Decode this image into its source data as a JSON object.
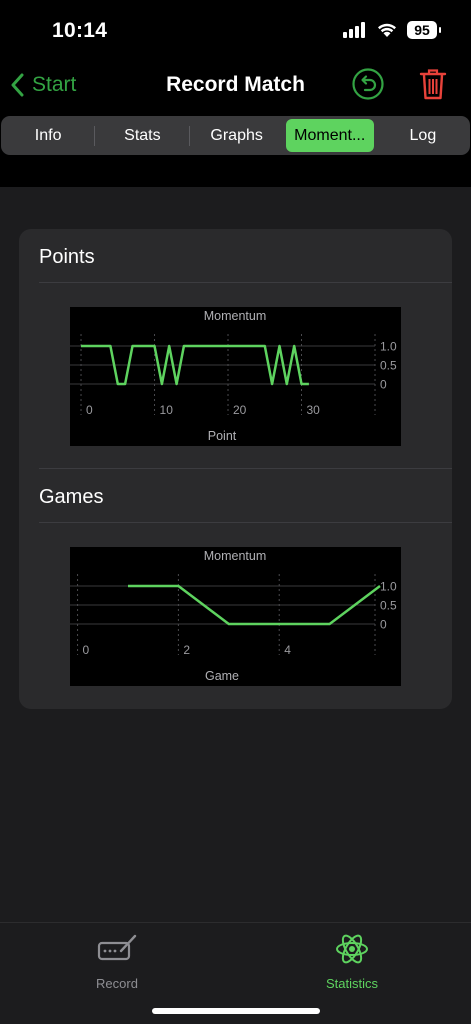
{
  "status": {
    "time": "10:14",
    "battery": "95"
  },
  "nav": {
    "back_label": "Start",
    "title": "Record Match"
  },
  "tabs": [
    {
      "label": "Info"
    },
    {
      "label": "Stats"
    },
    {
      "label": "Graphs"
    },
    {
      "label": "Moment..."
    },
    {
      "label": "Log"
    }
  ],
  "active_tab": 3,
  "sections": {
    "points_title": "Points",
    "games_title": "Games"
  },
  "colors": {
    "accent": "#5ed35f",
    "back_green": "#33a343",
    "trash_red": "#e8423a"
  },
  "chart_data": [
    {
      "type": "line",
      "title": "Momentum",
      "xlabel": "Point",
      "ylabel": "",
      "xlim": [
        -1.5,
        40
      ],
      "ylim": [
        0,
        1
      ],
      "x_ticks": [
        0,
        10,
        20,
        30
      ],
      "x_tick_labels": [
        "0",
        "10",
        "20",
        "30"
      ],
      "y_ticks": [
        0,
        0.5,
        1
      ],
      "y_tick_labels": [
        "0",
        "0.5",
        "1.0"
      ],
      "grid": true,
      "series": [
        {
          "x": [
            0,
            4,
            5,
            6,
            7,
            10,
            11,
            12,
            13,
            14,
            15,
            25,
            26,
            27,
            28,
            29,
            30,
            31
          ],
          "y": [
            1,
            1,
            0,
            0,
            1,
            1,
            0,
            1,
            0,
            1,
            1,
            1,
            0,
            1,
            0,
            1,
            0,
            0
          ]
        }
      ]
    },
    {
      "type": "line",
      "title": "Momentum",
      "xlabel": "Game",
      "ylabel": "",
      "xlim": [
        -0.15,
        5.9
      ],
      "ylim": [
        0,
        1
      ],
      "x_ticks": [
        0,
        2,
        4
      ],
      "x_tick_labels": [
        "0",
        "2",
        "4"
      ],
      "y_ticks": [
        0,
        0.5,
        1
      ],
      "y_tick_labels": [
        "0",
        "0.5",
        "1.0"
      ],
      "grid": true,
      "series": [
        {
          "x": [
            1,
            2,
            3,
            4,
            5,
            6
          ],
          "y": [
            1,
            1,
            0,
            0,
            0,
            1
          ]
        }
      ]
    }
  ],
  "bottom_tabs": {
    "record_label": "Record",
    "statistics_label": "Statistics"
  }
}
